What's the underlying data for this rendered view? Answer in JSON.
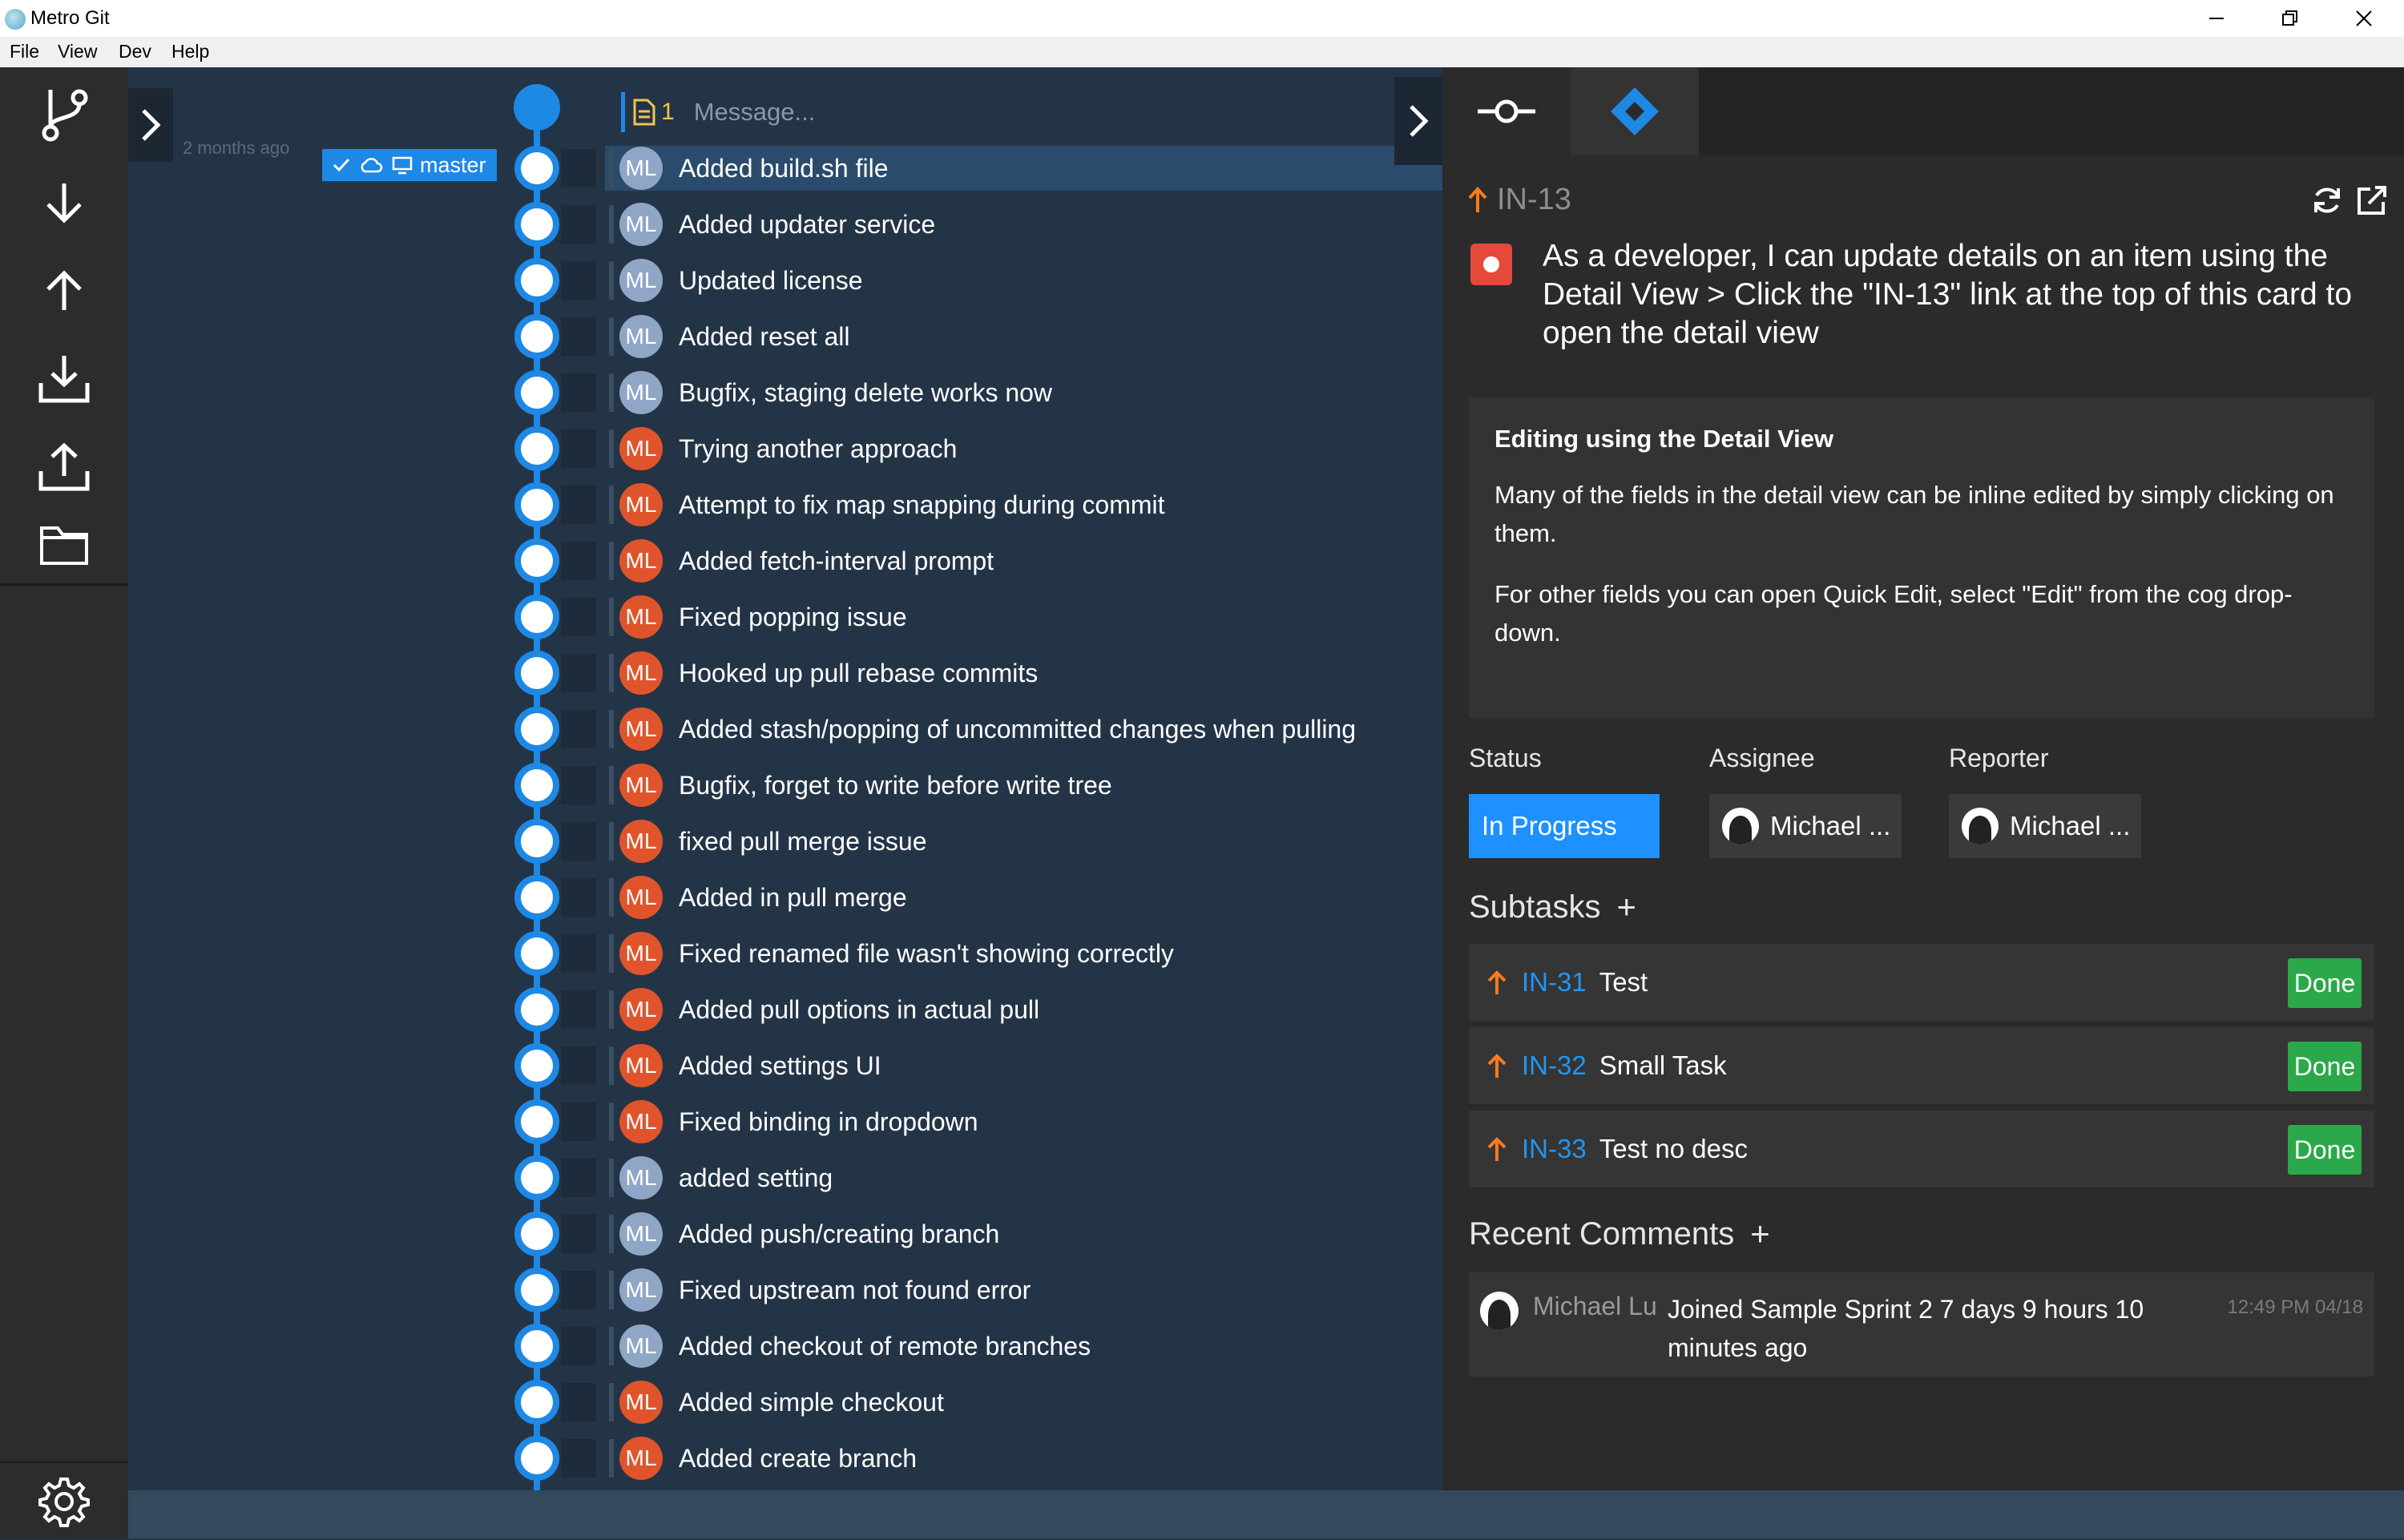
{
  "window": {
    "title": "Metro Git"
  },
  "menu": [
    "File",
    "View",
    "Dev",
    "Help"
  ],
  "toolbar": {
    "buttons": [
      "branch-icon",
      "pull-icon",
      "push-icon",
      "fetch-download-icon",
      "upload-icon",
      "folder-icon"
    ],
    "settings_icon": "gear-icon"
  },
  "graph": {
    "message_placeholder": "Message...",
    "staged_count": "1",
    "branch": {
      "name": "master",
      "age": "2 months ago"
    },
    "commits": [
      {
        "author": "ML",
        "message": "Added build.sh file",
        "avatar_color": "#8fa6c6"
      },
      {
        "author": "ML",
        "message": "Added updater service",
        "avatar_color": "#8fa6c6"
      },
      {
        "author": "ML",
        "message": "Updated license",
        "avatar_color": "#8fa6c6"
      },
      {
        "author": "ML",
        "message": "Added reset all",
        "avatar_color": "#8fa6c6"
      },
      {
        "author": "ML",
        "message": "Bugfix, staging delete works now",
        "avatar_color": "#8fa6c6"
      },
      {
        "author": "ML",
        "message": "Trying another approach",
        "avatar_color": "#e0542c"
      },
      {
        "author": "ML",
        "message": "Attempt to fix map snapping during commit",
        "avatar_color": "#e0542c"
      },
      {
        "author": "ML",
        "message": "Added fetch-interval prompt",
        "avatar_color": "#e0542c"
      },
      {
        "author": "ML",
        "message": "Fixed popping issue",
        "avatar_color": "#e0542c"
      },
      {
        "author": "ML",
        "message": "Hooked up pull rebase commits",
        "avatar_color": "#e0542c"
      },
      {
        "author": "ML",
        "message": "Added stash/popping of uncommitted changes when pulling",
        "avatar_color": "#e0542c"
      },
      {
        "author": "ML",
        "message": "Bugfix, forget to write before write tree",
        "avatar_color": "#e0542c"
      },
      {
        "author": "ML",
        "message": "fixed pull merge issue",
        "avatar_color": "#e0542c"
      },
      {
        "author": "ML",
        "message": "Added in pull merge",
        "avatar_color": "#e0542c"
      },
      {
        "author": "ML",
        "message": "Fixed renamed file wasn't showing correctly",
        "avatar_color": "#e0542c"
      },
      {
        "author": "ML",
        "message": "Added pull options in actual pull",
        "avatar_color": "#e0542c"
      },
      {
        "author": "ML",
        "message": "Added settings UI",
        "avatar_color": "#e0542c"
      },
      {
        "author": "ML",
        "message": "Fixed binding in dropdown",
        "avatar_color": "#e0542c"
      },
      {
        "author": "ML",
        "message": "added setting",
        "avatar_color": "#8fa6c6"
      },
      {
        "author": "ML",
        "message": "Added push/creating branch",
        "avatar_color": "#8fa6c6"
      },
      {
        "author": "ML",
        "message": "Fixed upstream not found error",
        "avatar_color": "#8fa6c6"
      },
      {
        "author": "ML",
        "message": "Added checkout of remote branches",
        "avatar_color": "#8fa6c6"
      },
      {
        "author": "ML",
        "message": "Added simple checkout",
        "avatar_color": "#e0542c"
      },
      {
        "author": "ML",
        "message": "Added create branch",
        "avatar_color": "#e0542c"
      }
    ]
  },
  "jira": {
    "tabs": [
      "commit-icon",
      "jira-icon"
    ],
    "issue": {
      "key": "IN-13",
      "summary": "As a developer, I can update details on an item using the Detail View > Click the \"IN-13\" link at the top of this card to open the detail view",
      "description": {
        "heading": "Editing using the Detail View",
        "paragraphs": [
          "Many of the fields in the detail view can be inline edited by simply clicking on them.",
          "For other fields you can open Quick Edit, select \"Edit\" from the cog drop-down."
        ]
      },
      "fields": {
        "status_label": "Status",
        "status": "In Progress",
        "assignee_label": "Assignee",
        "assignee": "Michael ...",
        "reporter_label": "Reporter",
        "reporter": "Michael ..."
      }
    },
    "subtasks_title": "Subtasks",
    "subtasks": [
      {
        "key": "IN-31",
        "title": "Test",
        "status": "Done"
      },
      {
        "key": "IN-32",
        "title": "Small Task",
        "status": "Done"
      },
      {
        "key": "IN-33",
        "title": "Test no desc",
        "status": "Done"
      }
    ],
    "comments_title": "Recent Comments",
    "comments": [
      {
        "author": "Michael Lu",
        "body": "Joined Sample Sprint 2 7 days 9 hours 10 minutes ago",
        "time": "12:49 PM 04/18"
      }
    ],
    "colors": {
      "accent": "#1e90ff",
      "done": "#2ba84a",
      "priority": "#f57c1f",
      "link": "#2196f3"
    }
  }
}
